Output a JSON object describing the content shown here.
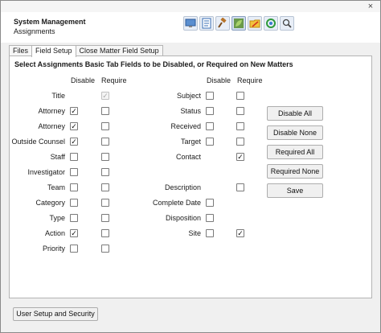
{
  "window": {
    "close_glyph": "×"
  },
  "header": {
    "title": "System Management",
    "subtitle": "Assignments"
  },
  "toolbar": {
    "buttons": [
      {
        "icon": "monitor-icon",
        "active": false
      },
      {
        "icon": "document-icon",
        "active": false
      },
      {
        "icon": "gavel-icon",
        "active": false
      },
      {
        "icon": "leaf-icon",
        "active": true
      },
      {
        "icon": "folder-icon",
        "active": false
      },
      {
        "icon": "recycle-icon",
        "active": false
      },
      {
        "icon": "magnifier-icon",
        "active": false
      }
    ]
  },
  "tabs": [
    {
      "label": "Files",
      "active": false
    },
    {
      "label": "Field Setup",
      "active": true
    },
    {
      "label": "Close Matter Field Setup",
      "active": false
    }
  ],
  "panel": {
    "heading": "Select Assignments Basic Tab Fields to be Disabled, or Required on New Matters",
    "col_disable": "Disable",
    "col_require": "Require"
  },
  "left_fields": [
    {
      "label": "Title",
      "disable": null,
      "require": "disabled-checked"
    },
    {
      "label": "Attorney",
      "disable": true,
      "require": false
    },
    {
      "label": "Attorney",
      "disable": true,
      "require": false
    },
    {
      "label": "Outside Counsel",
      "disable": true,
      "require": false
    },
    {
      "label": "Staff",
      "disable": false,
      "require": false
    },
    {
      "label": "Investigator",
      "disable": false,
      "require": false
    },
    {
      "label": "Team",
      "disable": false,
      "require": false
    },
    {
      "label": "Category",
      "disable": false,
      "require": false
    },
    {
      "label": "Type",
      "disable": false,
      "require": false
    },
    {
      "label": "Action",
      "disable": true,
      "require": false
    },
    {
      "label": "Priority",
      "disable": false,
      "require": false
    }
  ],
  "right_fields": [
    {
      "label": "Subject",
      "disable": false,
      "require": false
    },
    {
      "label": "Status",
      "disable": false,
      "require": false
    },
    {
      "label": "Received",
      "disable": false,
      "require": false
    },
    {
      "label": "Target",
      "disable": false,
      "require": false
    },
    {
      "label": "Contact",
      "disable": null,
      "require": true
    },
    {
      "label": "",
      "disable": null,
      "require": null
    },
    {
      "label": "Description",
      "disable": null,
      "require": false
    },
    {
      "label": "Complete Date",
      "disable": false,
      "require": null
    },
    {
      "label": "Disposition",
      "disable": false,
      "require": null
    },
    {
      "label": "Site",
      "disable": false,
      "require": true
    }
  ],
  "actions": {
    "disable_all": "Disable All",
    "disable_none": "Disable None",
    "required_all": "Required All",
    "required_none": "Required None",
    "save": "Save"
  },
  "footer": {
    "user_setup": "User Setup and Security"
  }
}
